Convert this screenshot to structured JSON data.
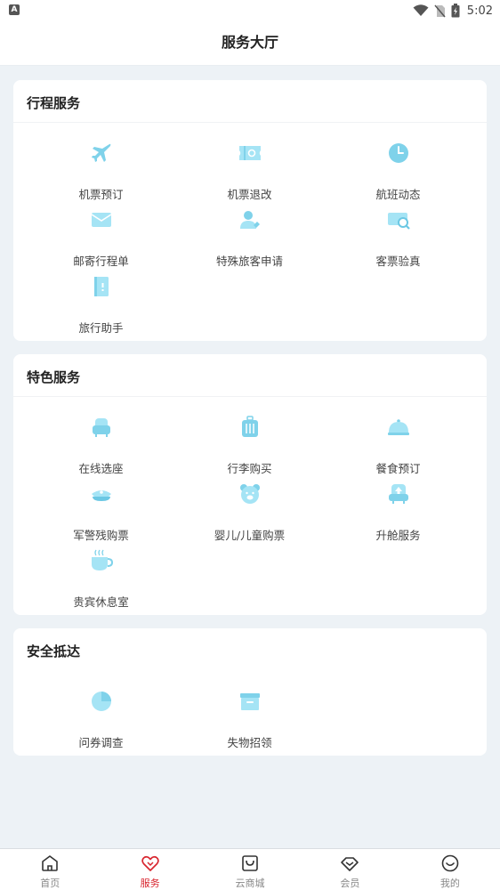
{
  "status_bar": {
    "time": "5:02",
    "notif_glyph": "A"
  },
  "header": {
    "title": "服务大厅"
  },
  "sections": [
    {
      "title": "行程服务",
      "items": [
        {
          "label": "机票预订",
          "icon": "airplane-icon"
        },
        {
          "label": "机票退改",
          "icon": "ticket-refund-icon"
        },
        {
          "label": "航班动态",
          "icon": "clock-icon"
        },
        {
          "label": "邮寄行程单",
          "icon": "envelope-icon"
        },
        {
          "label": "特殊旅客申请",
          "icon": "special-passenger-icon"
        },
        {
          "label": "客票验真",
          "icon": "ticket-verify-icon"
        },
        {
          "label": "旅行助手",
          "icon": "travel-guide-icon"
        }
      ]
    },
    {
      "title": "特色服务",
      "items": [
        {
          "label": "在线选座",
          "icon": "seat-icon"
        },
        {
          "label": "行李购买",
          "icon": "luggage-icon"
        },
        {
          "label": "餐食预订",
          "icon": "meal-cloche-icon"
        },
        {
          "label": "军警残购票",
          "icon": "police-cap-icon"
        },
        {
          "label": "婴儿/儿童购票",
          "icon": "bear-icon"
        },
        {
          "label": "升舱服务",
          "icon": "upgrade-seat-icon"
        },
        {
          "label": "贵宾休息室",
          "icon": "coffee-cup-icon"
        }
      ]
    },
    {
      "title": "安全抵达",
      "items": [
        {
          "label": "问券调查",
          "icon": "pie-survey-icon"
        },
        {
          "label": "失物招领",
          "icon": "lost-found-box-icon"
        }
      ]
    }
  ],
  "tab_bar": [
    {
      "label": "首页",
      "icon": "home-icon",
      "active": false
    },
    {
      "label": "服务",
      "icon": "heart-icon",
      "active": true
    },
    {
      "label": "云商城",
      "icon": "shopping-bag-icon",
      "active": false
    },
    {
      "label": "会员",
      "icon": "diamond-icon",
      "active": false
    },
    {
      "label": "我的",
      "icon": "smiley-icon",
      "active": false
    }
  ],
  "colors": {
    "accent": "#d8262f",
    "icon_light": "#a5e4f5",
    "icon_mid": "#6cc8e4",
    "background": "#edf2f6"
  }
}
